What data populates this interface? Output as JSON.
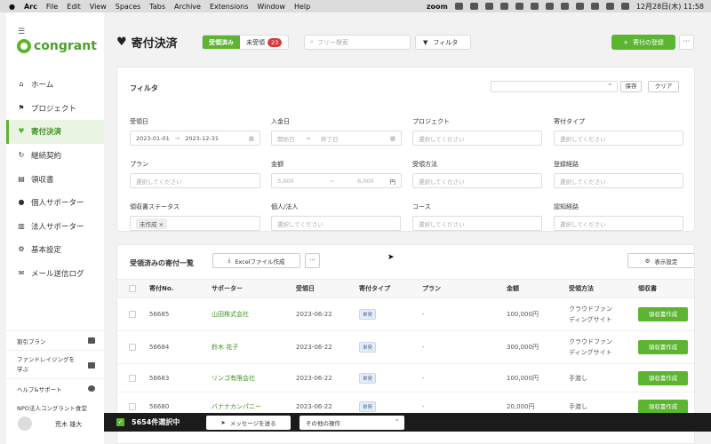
{
  "menubar": {
    "apple": "",
    "items": [
      "Arc",
      "File",
      "Edit",
      "View",
      "Spaces",
      "Tabs",
      "Archive",
      "Extensions",
      "Window",
      "Help"
    ],
    "zoom": "zoom",
    "clock": "12月28日(木) 11:58"
  },
  "sidebar": {
    "logo_text": "congrant",
    "items": [
      {
        "label": "ホーム",
        "icon": "home-icon"
      },
      {
        "label": "プロジェクト",
        "icon": "flag-icon"
      },
      {
        "label": "寄付決済",
        "icon": "heart-icon",
        "active": true
      },
      {
        "label": "継続契約",
        "icon": "refresh-icon"
      },
      {
        "label": "領収書",
        "icon": "receipt-icon"
      },
      {
        "label": "個人サポーター",
        "icon": "person-icon"
      },
      {
        "label": "法人サポーター",
        "icon": "building-icon"
      },
      {
        "label": "基本設定",
        "icon": "gear-icon"
      },
      {
        "label": "メール送信ログ",
        "icon": "mail-icon"
      }
    ],
    "plan": "割引プラン",
    "learn_line1": "ファンドレイジングを",
    "learn_line2": "学ぶ",
    "help": "ヘルプ&サポート",
    "org": "NPO法人コングラント食堂",
    "user": "荒木 雄大"
  },
  "header": {
    "title": "寄付決済",
    "tab_received": "受領済み",
    "tab_unreceived": "未受領",
    "unreceived_count": "23",
    "search_placeholder": "フリー検索",
    "filter_label": "フィルタ",
    "register_label": "寄付の登録",
    "more_label": "···"
  },
  "filter": {
    "title": "フィルタ",
    "save": "保存",
    "clear": "クリア",
    "fields": {
      "received_date": {
        "label": "受領日",
        "from": "2023-01-01",
        "to": "2023-12-31"
      },
      "payment_date": {
        "label": "入金日",
        "from": "開始日",
        "to": "終了日"
      },
      "project": {
        "label": "プロジェクト",
        "placeholder": "選択してください"
      },
      "donation_type": {
        "label": "寄付タイプ",
        "placeholder": "選択してください"
      },
      "plan": {
        "label": "プラン",
        "placeholder": "選択してください"
      },
      "amount": {
        "label": "金額",
        "from": "3,000",
        "to": "6,000",
        "unit": "円"
      },
      "receive_method": {
        "label": "受領方法",
        "placeholder": "選択してください"
      },
      "register_route": {
        "label": "登録経路",
        "placeholder": "選択してください"
      },
      "receipt_status": {
        "label": "領収書ステータス",
        "chip": "未作成"
      },
      "person_corp": {
        "label": "個人/法人",
        "placeholder": "選択してください"
      },
      "course": {
        "label": "コース",
        "placeholder": "選択してください"
      },
      "awareness": {
        "label": "認知経路",
        "placeholder": "選択してください"
      }
    }
  },
  "list": {
    "title": "受領済みの寄付一覧",
    "excel": "Excelファイル作成",
    "more": "···",
    "display": "表示設定",
    "columns": [
      "寄付No.",
      "サポーター",
      "受領日",
      "寄付タイプ",
      "プラン",
      "金額",
      "受領方法",
      "領収書"
    ],
    "rows": [
      {
        "no": "56685",
        "supporter": "山田株式会社",
        "date": "2023-06-22",
        "type": "単発",
        "plan": "-",
        "amount": "100,000円",
        "method1": "クラウドファン",
        "method2": "ディングサイト",
        "action": "領収書作成"
      },
      {
        "no": "56684",
        "supporter": "鈴木 花子",
        "date": "2023-06-22",
        "type": "単発",
        "plan": "-",
        "amount": "300,000円",
        "method1": "クラウドファン",
        "method2": "ディングサイト",
        "action": "領収書作成"
      },
      {
        "no": "56683",
        "supporter": "リンゴ有限会社",
        "date": "2023-06-22",
        "type": "単発",
        "plan": "-",
        "amount": "100,000円",
        "method1": "手渡し",
        "method2": "",
        "action": "領収書作成"
      },
      {
        "no": "56680",
        "supporter": "バナナカンパニー",
        "date": "2023-06-22",
        "type": "単発",
        "plan": "-",
        "amount": "20,000円",
        "method1": "手渡し",
        "method2": "",
        "action": "領収書作成"
      }
    ]
  },
  "bottombar": {
    "selected": "5654件選択中",
    "send_message": "メッセージを送る",
    "other_ops": "その他の操作"
  },
  "colors": {
    "brand": "#5cb531",
    "badge": "#d93b3b"
  }
}
